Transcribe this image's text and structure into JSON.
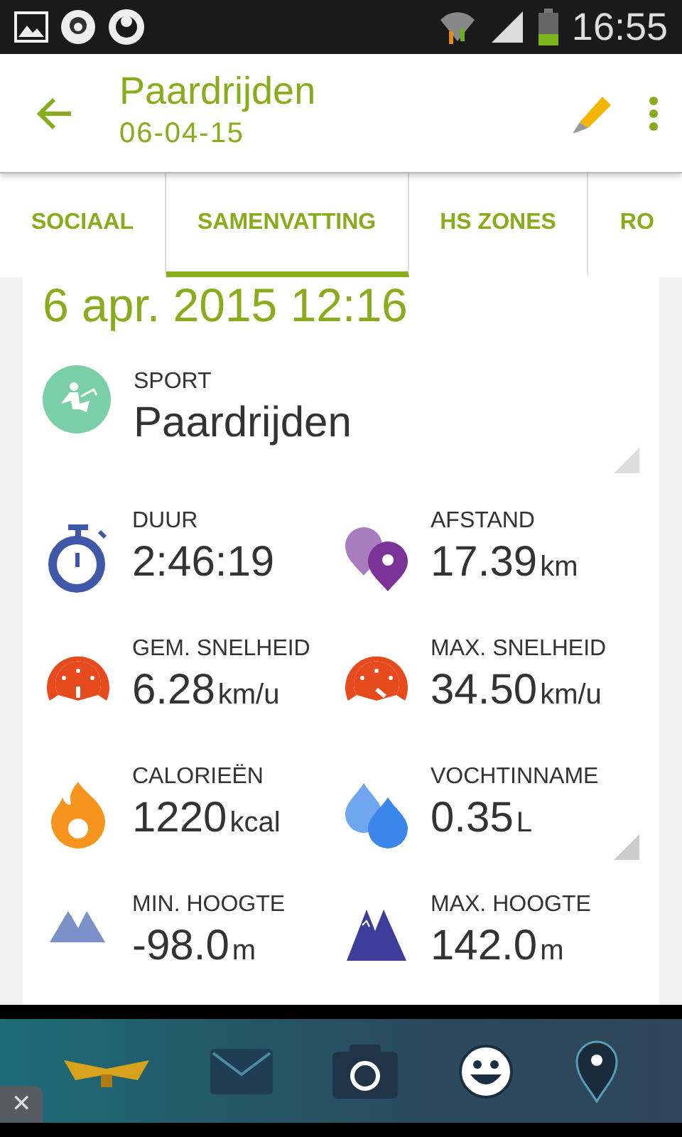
{
  "status_bar": {
    "time": "16:55"
  },
  "app_bar": {
    "title": "Paardrijden",
    "subtitle": "06-04-15"
  },
  "tabs": [
    {
      "label": "SOCIAAL",
      "selected": false
    },
    {
      "label": "SAMENVATTING",
      "selected": true
    },
    {
      "label": "HS ZONES",
      "selected": false
    },
    {
      "label": "RO",
      "selected": false
    }
  ],
  "date": "6 apr. 2015 12:16",
  "sport": {
    "label": "SPORT",
    "value": "Paardrijden"
  },
  "stats": [
    {
      "kind": "stopwatch",
      "label": "DUUR",
      "value": "2:46:19",
      "dropdown": false
    },
    {
      "kind": "pins",
      "label": "AFSTAND",
      "value": "17.39",
      "unit": "km",
      "dropdown": false
    },
    {
      "kind": "gauge-avg",
      "label": "GEM. SNELHEID",
      "value": "6.28",
      "unit": "km/u",
      "dropdown": false
    },
    {
      "kind": "gauge-max",
      "label": "MAX. SNELHEID",
      "value": "34.50",
      "unit": "km/u",
      "dropdown": false
    },
    {
      "kind": "flame",
      "label": "CALORIEËN",
      "value": "1220",
      "unit": "kcal",
      "dropdown": false
    },
    {
      "kind": "drops",
      "label": "VOCHTINNAME",
      "value": "0.35",
      "unit": "L",
      "dropdown": true
    },
    {
      "kind": "mountain-low",
      "label": "MIN. HOOGTE",
      "value": "-98.0",
      "unit": "m",
      "dropdown": false
    },
    {
      "kind": "mountain-high",
      "label": "MAX. HOOGTE",
      "value": "142.0",
      "unit": "m",
      "dropdown": false
    }
  ],
  "ad": {
    "close": "✕"
  }
}
